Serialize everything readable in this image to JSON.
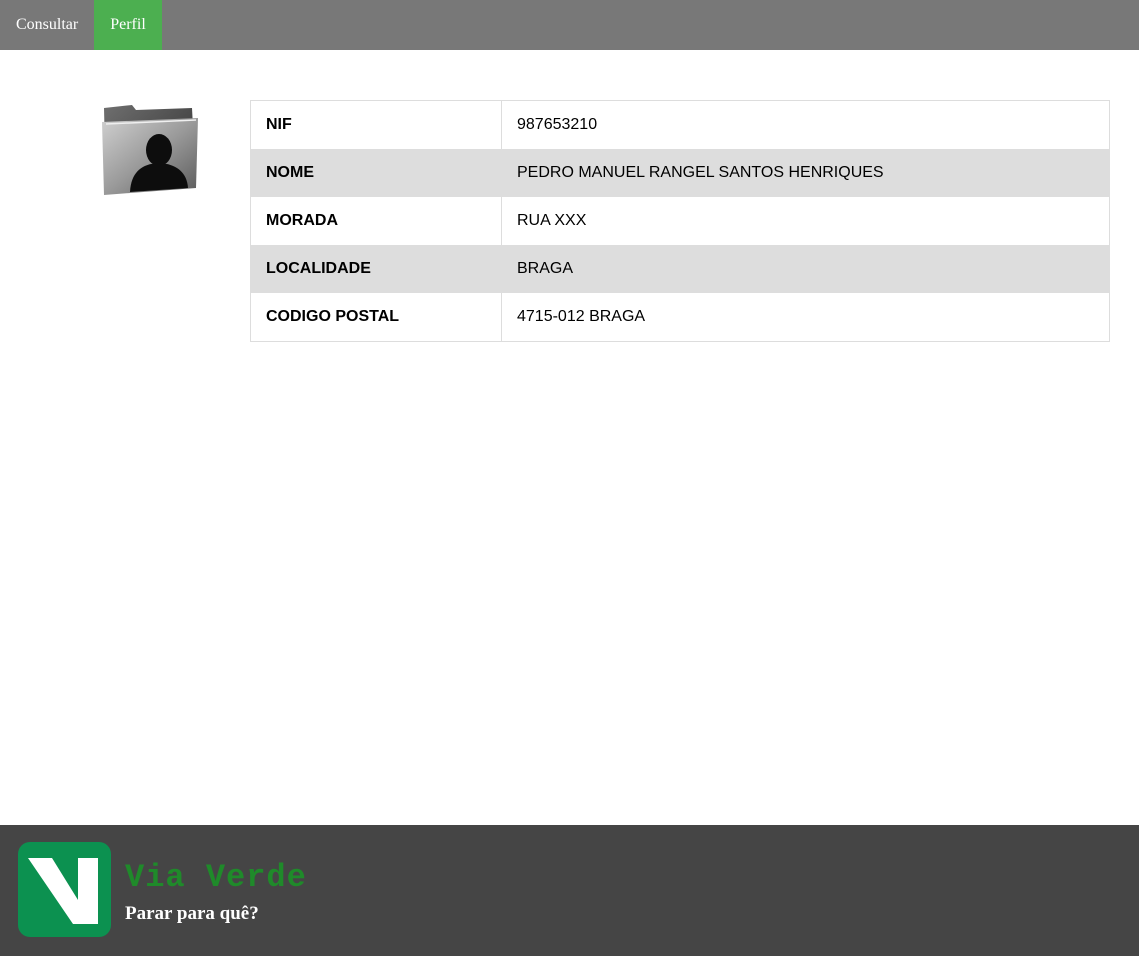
{
  "nav": {
    "items": [
      {
        "label": "Consultar",
        "active": false
      },
      {
        "label": "Perfil",
        "active": true
      }
    ],
    "active_color": "#4caf50",
    "bar_color": "#787878"
  },
  "profile": {
    "icon": "user-folder-icon",
    "rows": [
      {
        "label": "NIF",
        "value": "987653210"
      },
      {
        "label": "NOME",
        "value": "PEDRO MANUEL RANGEL SANTOS HENRIQUES"
      },
      {
        "label": "MORADA",
        "value": "RUA XXX"
      },
      {
        "label": "LOCALIDADE",
        "value": "BRAGA"
      },
      {
        "label": "CODIGO POSTAL",
        "value": "4715-012 BRAGA"
      }
    ]
  },
  "footer": {
    "logo_icon": "via-verde-v-logo",
    "brand": "Via Verde",
    "tagline": "Parar para quê?",
    "brand_color": "#1f8a2a",
    "background": "#454545"
  }
}
